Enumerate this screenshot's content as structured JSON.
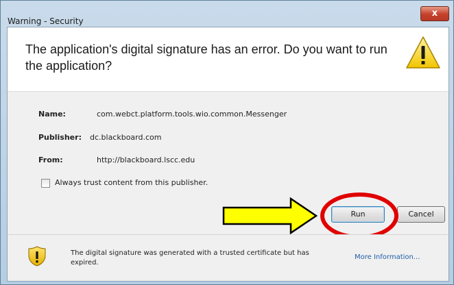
{
  "window": {
    "title": "Warning - Security",
    "close_glyph": "x"
  },
  "header": {
    "message": "The application's digital signature has an error.  Do you want to run the application?",
    "icon": "warning-triangle-icon"
  },
  "details": {
    "name_label": "Name:",
    "name_value": "com.webct.platform.tools.wio.common.Messenger",
    "publisher_label": "Publisher:",
    "publisher_value": "dc.blackboard.com",
    "from_label": "From:",
    "from_value": "http://blackboard.lscc.edu"
  },
  "checkbox": {
    "label": "Always trust content from this publisher.",
    "checked": false
  },
  "buttons": {
    "run_label": "Run",
    "cancel_label": "Cancel"
  },
  "annotation": {
    "arrow_color": "#ffff00",
    "circle_color": "#e00000"
  },
  "footer": {
    "icon": "shield-warning-icon",
    "message": "The digital signature was generated with a trusted certificate but has expired.",
    "more_info_label": "More Information..."
  }
}
